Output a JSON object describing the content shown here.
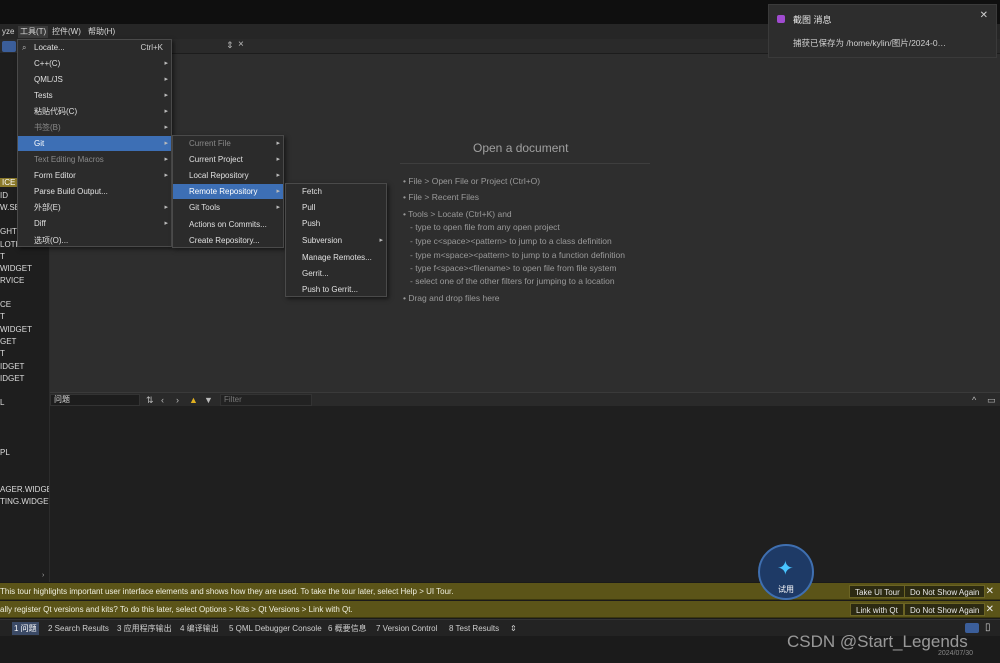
{
  "menubar": {
    "items": [
      "yze",
      "工具(T)",
      "控件(W)",
      "帮助(H)"
    ]
  },
  "tools_menu": {
    "items": [
      {
        "label": "Locate...",
        "shortcut": "Ctrl+K",
        "icon": "search-icon"
      },
      {
        "label": "C++(C)"
      },
      {
        "label": "QML/JS"
      },
      {
        "label": "Tests"
      },
      {
        "label": "粘贴代码(C)"
      },
      {
        "label": "书签(B)"
      },
      {
        "label": "Git"
      },
      {
        "label": "Text Editing Macros"
      },
      {
        "label": "Form Editor"
      },
      {
        "label": "Parse Build Output..."
      },
      {
        "label": "外部(E)"
      },
      {
        "label": "Diff"
      },
      {
        "label": "选项(O)..."
      }
    ]
  },
  "git_menu": {
    "items": [
      {
        "label": "Current File"
      },
      {
        "label": "Current Project"
      },
      {
        "label": "Local Repository"
      },
      {
        "label": "Remote Repository"
      },
      {
        "label": "Git Tools"
      },
      {
        "label": "Actions on Commits..."
      },
      {
        "label": "Create Repository..."
      }
    ]
  },
  "remote_menu": {
    "items": [
      {
        "label": "Fetch"
      },
      {
        "label": "Pull"
      },
      {
        "label": "Push"
      },
      {
        "label": "Subversion"
      },
      {
        "label": "Manage Remotes..."
      },
      {
        "label": "Gerrit..."
      },
      {
        "label": "Push to Gerrit..."
      }
    ]
  },
  "left_panel": {
    "items": [
      "ICE",
      "ID",
      "W.SE",
      "GHT",
      "LOTH",
      "T",
      "WIDGET",
      "RVICE",
      "CE",
      "T",
      "WIDGET",
      "GET",
      "T",
      "IDGET",
      "IDGET",
      "L",
      "PL",
      "AGER.WIDGET",
      "TING.WIDGET"
    ]
  },
  "editor": {
    "open_title": "Open a document",
    "tips": [
      "• File > Open File or Project (Ctrl+O)",
      "• File > Recent Files",
      "• Tools > Locate (Ctrl+K) and",
      "- type to open file from any open project",
      "- type c<space><pattern> to jump to a class definition",
      "- type m<space><pattern> to jump to a function definition",
      "- type f<space><filename> to open file from file system",
      "- select one of the other filters for jumping to a location",
      "• Drag and drop files here"
    ]
  },
  "issues": {
    "combo": "问题",
    "filter_placeholder": "Filter"
  },
  "banners": {
    "tour_text": "This tour highlights important user interface elements and shows how they are used. To take the tour later, select Help > UI Tour.",
    "tour_btn": "Take UI Tour",
    "tour_dismiss": "Do Not Show Again",
    "qt_text": "ally register Qt versions and kits? To do this later, select Options > Kits > Qt Versions > Link with Qt.",
    "qt_btn": "Link with Qt",
    "qt_dismiss": "Do Not Show Again"
  },
  "status_panes": [
    "1 问题",
    "2 Search Results",
    "3 应用程序输出",
    "4 编译输出",
    "5 QML Debugger Console",
    "6 概要信息",
    "7 Version Control",
    "8 Test Results"
  ],
  "notification": {
    "title": "截图 消息",
    "body": "捕获已保存为 /home/kylin/图片/2024-0…"
  },
  "chat_widget": {
    "label": "试用"
  },
  "watermark": "CSDN @Start_Legends",
  "date": "2024/07/30"
}
